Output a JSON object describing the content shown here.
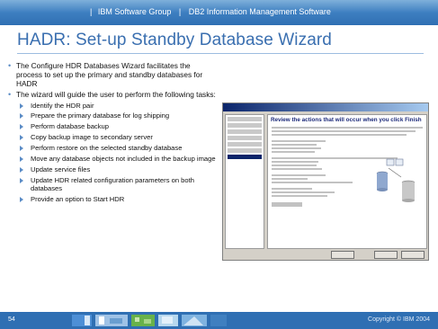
{
  "header": {
    "company": "IBM Software Group",
    "separator": "|",
    "division": "DB2 Information Management Software"
  },
  "title": "HADR: Set-up Standby Database Wizard",
  "bullets": [
    {
      "text": "The Configure HDR Databases Wizard facilitates the process to set up the primary and standby databases for HADR",
      "subitems": []
    },
    {
      "text": "The wizard will guide the user to perform the following tasks:",
      "subitems": [
        "Identify the HDR pair",
        "Prepare the primary database for log shipping",
        "Perform database backup",
        "Copy backup image to secondary server",
        "Perform restore on the selected standby database",
        "Move any database objects not included in the backup image",
        "Update service files",
        "Update HDR related configuration parameters on both databases",
        "Provide an option to Start HDR"
      ]
    }
  ],
  "screenshot": {
    "heading": "Review the actions that will occur when you click Finish"
  },
  "footer": {
    "page_number": "54",
    "copyright": "Copyright © IBM 2004"
  },
  "colors": {
    "header_blue": "#3e7fc1",
    "title_blue": "#3a6fb0",
    "bullet_blue": "#5b8cc6",
    "footer_blue": "#2f6fb3"
  }
}
